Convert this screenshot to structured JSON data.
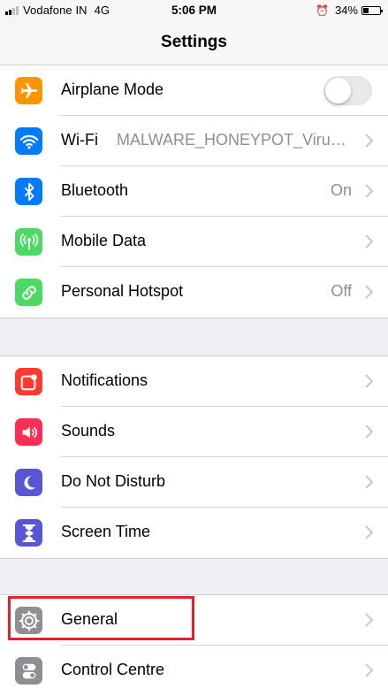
{
  "status_bar": {
    "carrier": "Vodafone IN",
    "network": "4G",
    "time": "5:06 PM",
    "alarm_icon": "alarm-clock-icon",
    "battery_percent": "34%",
    "battery_level": 0.34,
    "signal_bars_filled": 2,
    "signal_bars_total": 4
  },
  "nav": {
    "title": "Settings"
  },
  "groups": [
    {
      "rows": [
        {
          "label": "Airplane Mode",
          "icon": "airplane-icon",
          "color": "#ff9500",
          "toggle": false
        },
        {
          "label": "Wi-Fi",
          "icon": "wifi-icon",
          "color": "#007aff",
          "value": "MALWARE_HONEYPOT_Virus_Warehouse"
        },
        {
          "label": "Bluetooth",
          "icon": "bluetooth-icon",
          "color": "#007aff",
          "value": "On"
        },
        {
          "label": "Mobile Data",
          "icon": "antenna-icon",
          "color": "#4cd964",
          "value": ""
        },
        {
          "label": "Personal Hotspot",
          "icon": "hotspot-link-icon",
          "color": "#4cd964",
          "value": "Off"
        }
      ]
    },
    {
      "rows": [
        {
          "label": "Notifications",
          "icon": "notifications-icon",
          "color": "#ff3b30"
        },
        {
          "label": "Sounds",
          "icon": "speaker-icon",
          "color": "#ff2d55"
        },
        {
          "label": "Do Not Disturb",
          "icon": "moon-icon",
          "color": "#5856d6"
        },
        {
          "label": "Screen Time",
          "icon": "hourglass-icon",
          "color": "#5856d6"
        }
      ]
    },
    {
      "rows": [
        {
          "label": "General",
          "icon": "gear-icon",
          "color": "#8e8e93"
        },
        {
          "label": "Control Centre",
          "icon": "switches-icon",
          "color": "#8e8e93"
        }
      ]
    }
  ],
  "highlight_color": "#e0202f"
}
